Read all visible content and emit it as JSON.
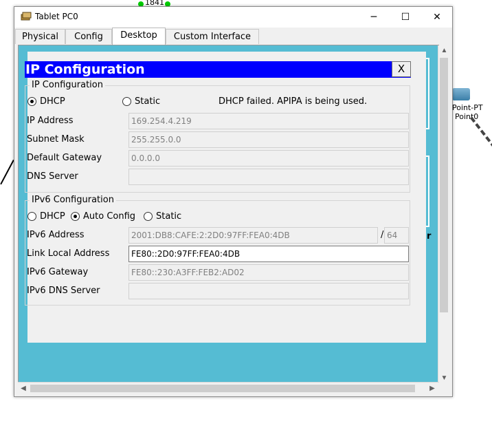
{
  "background": {
    "router_label": "1841",
    "device_label_line1": "Point-PT",
    "device_label_line2": "Point0",
    "stray_letter": "r"
  },
  "window": {
    "title": "Tablet PC0",
    "minimize": "─",
    "maximize": "☐",
    "close": "✕"
  },
  "tabs": [
    {
      "label": "Physical"
    },
    {
      "label": "Config"
    },
    {
      "label": "Desktop"
    },
    {
      "label": "Custom Interface"
    }
  ],
  "active_tab": "Desktop",
  "dialog": {
    "title": "IP Configuration",
    "close_label": "X",
    "ipv4": {
      "group_label": "IP Configuration",
      "dhcp_label": "DHCP",
      "static_label": "Static",
      "mode": "DHCP",
      "status": "DHCP failed. APIPA is being used.",
      "ip_address_label": "IP Address",
      "ip_address": "169.254.4.219",
      "subnet_mask_label": "Subnet Mask",
      "subnet_mask": "255.255.0.0",
      "gateway_label": "Default Gateway",
      "gateway": "0.0.0.0",
      "dns_label": "DNS Server",
      "dns": ""
    },
    "ipv6": {
      "group_label": "IPv6 Configuration",
      "dhcp_label": "DHCP",
      "auto_label": "Auto Config",
      "static_label": "Static",
      "mode": "Auto Config",
      "address_label": "IPv6 Address",
      "address": "2001:DB8:CAFE:2:2D0:97FF:FEA0:4DB",
      "prefix_separator": "/",
      "prefix": "64",
      "link_local_label": "Link Local Address",
      "link_local": "FE80::2D0:97FF:FEA0:4DB",
      "gateway_label": "IPv6 Gateway",
      "gateway": "FE80::230:A3FF:FEB2:AD02",
      "dns_label": "IPv6 DNS Server",
      "dns": ""
    }
  }
}
